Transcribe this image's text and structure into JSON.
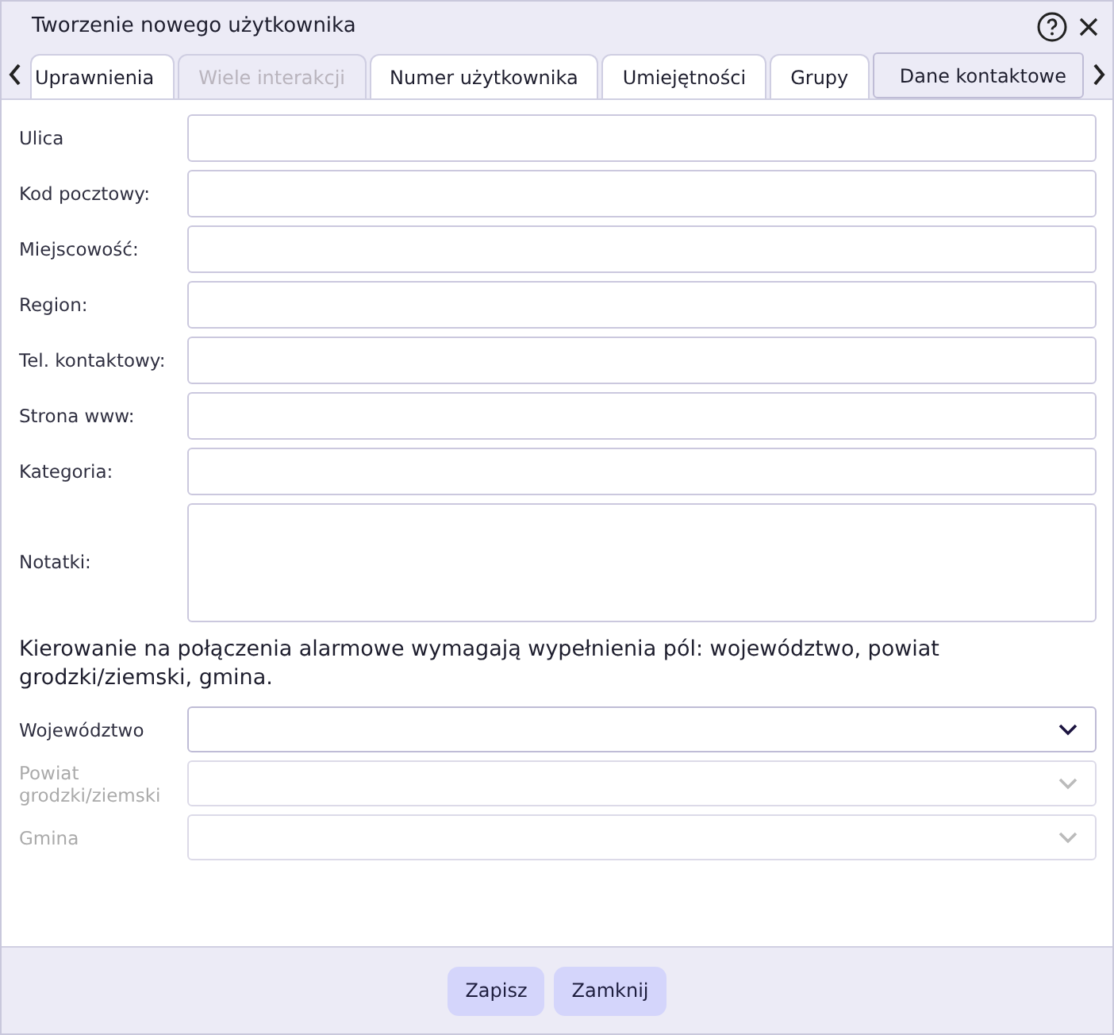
{
  "window": {
    "title": "Tworzenie nowego użytkownika"
  },
  "tabs": [
    {
      "label": "Uprawnienia",
      "selected": false,
      "disabled": false
    },
    {
      "label": "Wiele interakcji",
      "selected": false,
      "disabled": true
    },
    {
      "label": "Numer użytkownika",
      "selected": false,
      "disabled": false
    },
    {
      "label": "Umiejętności",
      "selected": false,
      "disabled": false
    },
    {
      "label": "Grupy",
      "selected": false,
      "disabled": false
    },
    {
      "label": "Dane kontaktowe",
      "selected": true,
      "disabled": false
    }
  ],
  "fields": [
    {
      "label": "Ulica",
      "kind": "input"
    },
    {
      "label": "Kod pocztowy:",
      "kind": "input"
    },
    {
      "label": "Miejscowość:",
      "kind": "input"
    },
    {
      "label": "Region:",
      "kind": "input"
    },
    {
      "label": "Tel. kontaktowy:",
      "kind": "input"
    },
    {
      "label": "Strona www:",
      "kind": "input"
    },
    {
      "label": "Kategoria:",
      "kind": "input"
    },
    {
      "label": "Notatki:",
      "kind": "textarea"
    }
  ],
  "note": "Kierowanie na połączenia alarmowe wymagają wypełnienia pól: województwo, powiat grodzki/ziemski, gmina.",
  "selects": [
    {
      "label": "Województwo",
      "disabled": false
    },
    {
      "label": "Powiat grodzki/ziemski",
      "disabled": true
    },
    {
      "label": "Gmina",
      "disabled": true
    }
  ],
  "buttons": [
    "Zapisz",
    "Zamknij"
  ]
}
